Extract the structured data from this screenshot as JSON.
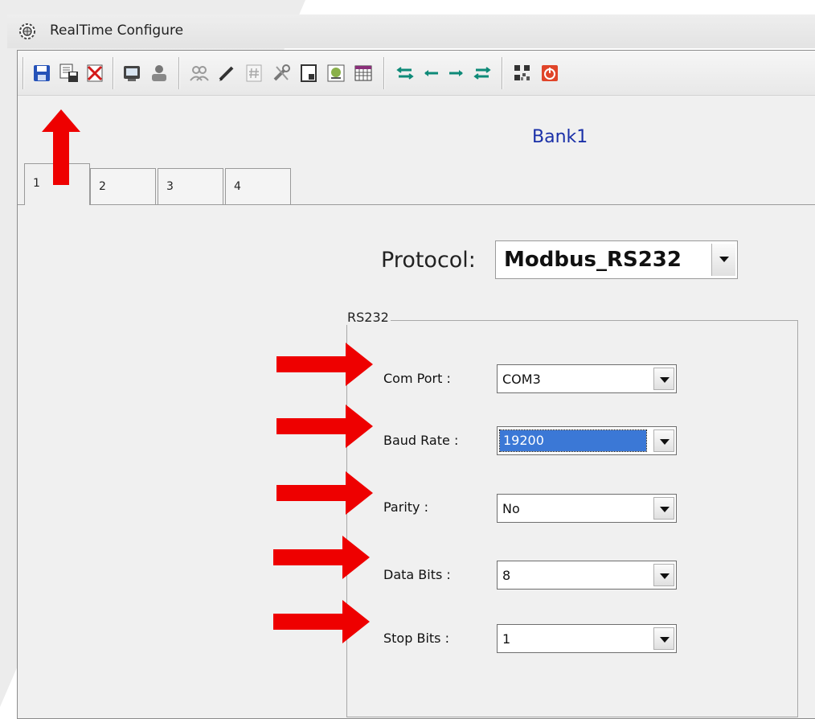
{
  "window": {
    "title": "RealTime Configure",
    "app_icon": "gear-globe-icon"
  },
  "toolbar": {
    "buttons": [
      {
        "icon": "save-icon"
      },
      {
        "icon": "save-as-icon"
      },
      {
        "icon": "delete-icon"
      },
      {
        "icon": "device-icon"
      },
      {
        "icon": "network-icon"
      },
      {
        "icon": "users-icon"
      },
      {
        "icon": "pencil-icon"
      },
      {
        "icon": "hash-icon"
      },
      {
        "icon": "tools-icon"
      },
      {
        "icon": "window-icon"
      },
      {
        "icon": "image-icon"
      },
      {
        "icon": "calendar-grid-icon"
      },
      {
        "icon": "move-first-icon"
      },
      {
        "icon": "move-left-icon"
      },
      {
        "icon": "move-right-icon"
      },
      {
        "icon": "move-last-icon"
      },
      {
        "icon": "qr-code-icon"
      },
      {
        "icon": "power-icon"
      }
    ]
  },
  "bank_title": "Bank1",
  "tabs": [
    {
      "label": "1",
      "active": true
    },
    {
      "label": "2",
      "active": false
    },
    {
      "label": "3",
      "active": false
    },
    {
      "label": "4",
      "active": false
    }
  ],
  "protocol": {
    "label": "Protocol:",
    "value": "Modbus_RS232"
  },
  "rs232": {
    "title": "RS232",
    "fields": [
      {
        "label": "Com Port :",
        "value": "COM3",
        "selected": false
      },
      {
        "label": "Baud Rate :",
        "value": "19200",
        "selected": true
      },
      {
        "label": "Parity :",
        "value": "No",
        "selected": false
      },
      {
        "label": "Data Bits :",
        "value": "8",
        "selected": false
      },
      {
        "label": "Stop Bits :",
        "value": "1",
        "selected": false
      }
    ]
  },
  "colors": {
    "annotation_arrow": "#ee0000",
    "bank_title": "#1a30a8",
    "selection": "#3b78d6"
  }
}
